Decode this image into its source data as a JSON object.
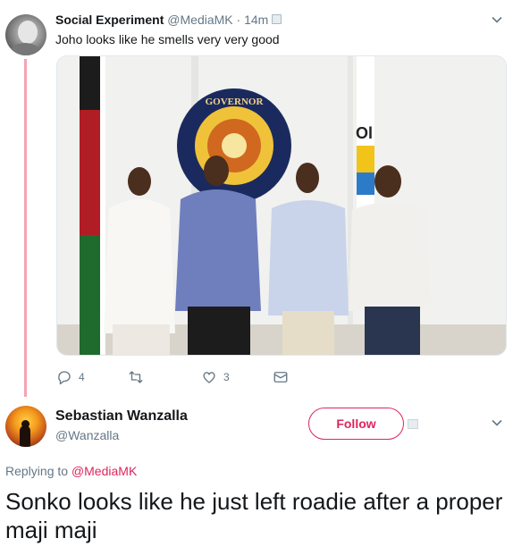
{
  "colors": {
    "accent": "#e0245e",
    "thread_line": "#f5a3b4",
    "secondary_text": "#657786"
  },
  "tweet1": {
    "author_name": "Social Experiment",
    "handle": "@MediaMK",
    "separator": "·",
    "time": "14m",
    "text": "Joho looks like he smells very very good",
    "photo": {
      "emblem_top_text": "GOVERNOR",
      "banner_text": "Ol"
    },
    "actions": {
      "reply_count": "4",
      "retweet_count": "",
      "like_count": "3"
    }
  },
  "tweet2": {
    "author_name": "Sebastian Wanzalla",
    "handle": "@Wanzalla",
    "follow_label": "Follow",
    "replying_to_label": "Replying to",
    "replying_to_handle": "@MediaMK",
    "text": "Sonko looks like he just left roadie after a proper maji maji"
  }
}
